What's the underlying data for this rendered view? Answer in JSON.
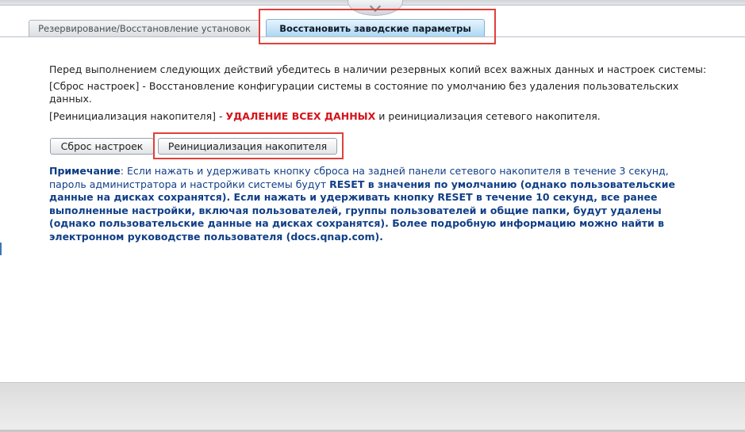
{
  "tabs": [
    {
      "label": "Резервирование/Восстановление установок",
      "active": false
    },
    {
      "label": "Восстановить заводские параметры",
      "active": true
    }
  ],
  "intro": "Перед выполнением следующих действий убедитесь в наличии резервных копий всех важных данных и настроек системы:",
  "reset_line": "[Сброс настроек] - Восстановление конфигурации системы в состояние по умолчанию без удаления пользовательских данных.",
  "reinit_line": {
    "prefix": "[Реинициализация накопителя] - ",
    "danger": "УДАЛЕНИЕ ВСЕХ ДАННЫХ",
    "suffix": " и реинициализация сетевого накопителя."
  },
  "buttons": {
    "reset": "Сброс настроек",
    "reinit": "Реинициализация накопителя"
  },
  "note": {
    "label": "Примечание",
    "part1": ": Если нажать и удерживать кнопку сброса на задней панели сетевого накопителя в течение 3 секунд, пароль администратора и настройки системы будут ",
    "part2": "RESET в значения по умолчанию (однако пользовательские данные на дисках сохранятся). Если нажать и удерживать кнопку RESET в течение 10 секунд, все ранее выполненные настройки, включая пользователей, группы пользователей и общие папки, будут удалены (однако пользовательские данные на дисках сохранятся). Более подробную информацию можно найти в электронном руководстве пользователя (docs.qnap.com)."
  },
  "colors": {
    "danger": "#d3141a",
    "note_text": "#103f87",
    "highlight": "#e0403c",
    "active_tab": "#a9d6f3"
  }
}
